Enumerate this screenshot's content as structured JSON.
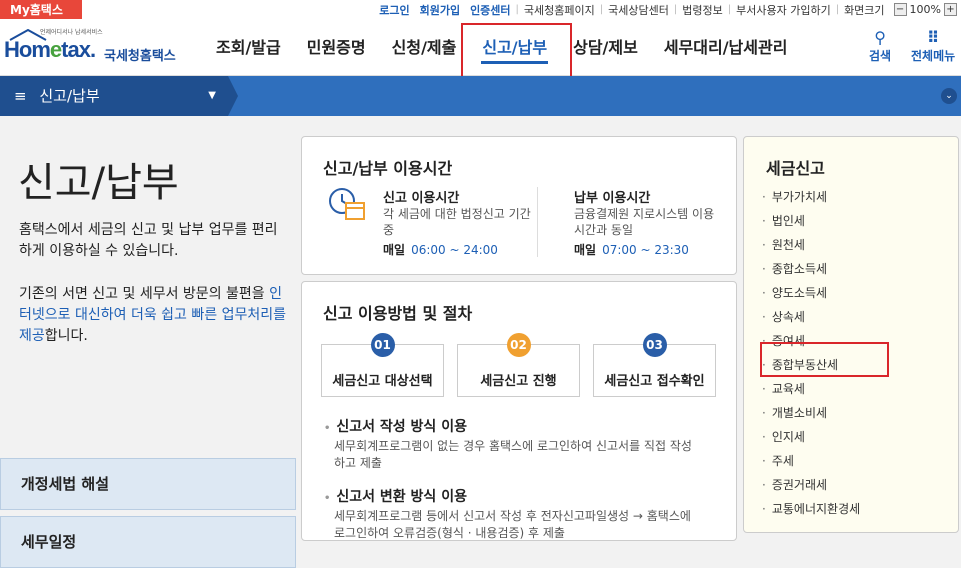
{
  "topbar": {
    "my_home": "My홈택스",
    "links_bold": [
      "로그인",
      "회원가입",
      "인증센터"
    ],
    "links": [
      "국세청홈페이지",
      "국세상담센터",
      "법령정보",
      "부서사용자 가입하기",
      "화면크기"
    ],
    "zoom_value": "100%",
    "zoom_minus": "−",
    "zoom_plus": "+"
  },
  "header": {
    "logo_tiny": "언제어디서나 납세서비스",
    "logo_home_a": "Hom",
    "logo_home_e": "e",
    "logo_home_b": "tax.",
    "logo_nts": "국세청홈택스",
    "menus": [
      "조회/발급",
      "민원증명",
      "신청/제출",
      "신고/납부",
      "상담/제보",
      "세무대리/납세관리"
    ],
    "active_menu": "신고/납부",
    "search_label": "검색",
    "allmenu_label": "전체메뉴"
  },
  "navbar": {
    "section": "신고/납부",
    "menu_icon": "≡",
    "caret": "▼",
    "right_icon": "⌄"
  },
  "left": {
    "title": "신고/납부",
    "desc1": "홈택스에서 세금의 신고 및 납부 업무를 편리하게 이용하실 수 있습니다.",
    "desc2_pre": "기존의 서면 신고 및 세무서 방문의 불편을 ",
    "desc2_hl": "인터넷으로 대신하여 더욱 쉽고 빠른 업무처리를 제공",
    "desc2_post": "합니다.",
    "btn1": "개정세법 해설",
    "btn2": "세무일정"
  },
  "hours": {
    "title": "신고/납부 이용시간",
    "report_title": "신고 이용시간",
    "report_desc": "각 세금에 대한 법정신고 기간 중",
    "report_daily": "매일",
    "report_time": "06:00 ~ 24:00",
    "pay_title": "납부 이용시간",
    "pay_desc": "금융결제원 지로시스템 이용시간과 동일",
    "pay_daily": "매일",
    "pay_time": "07:00 ~ 23:30"
  },
  "procedure": {
    "title": "신고 이용방법 및 절차",
    "steps": [
      {
        "num": "01",
        "label": "세금신고 대상선택",
        "color": "#2a5ea8"
      },
      {
        "num": "02",
        "label": "세금신고 진행",
        "color": "#f0a030"
      },
      {
        "num": "03",
        "label": "세금신고 접수확인",
        "color": "#2a5ea8"
      }
    ],
    "method1_title": "신고서 작성 방식 이용",
    "method1_desc": "세무회계프로그램이 없는 경우 홈택스에 로그인하여 신고서를 직접 작성하고 제출",
    "method2_title": "신고서 변환 방식 이용",
    "method2_desc": "세무회계프로그램 등에서 신고서 작성 후 전자신고파일생성 → 홈택스에 로그인하여 오류검증(형식 · 내용검증) 후 제출"
  },
  "taxes": {
    "title": "세금신고",
    "items": [
      "부가가치세",
      "법인세",
      "원천세",
      "종합소득세",
      "양도소득세",
      "상속세",
      "증여세",
      "종합부동산세",
      "교육세",
      "개별소비세",
      "인지세",
      "주세",
      "증권거래세",
      "교통에너지환경세"
    ]
  }
}
